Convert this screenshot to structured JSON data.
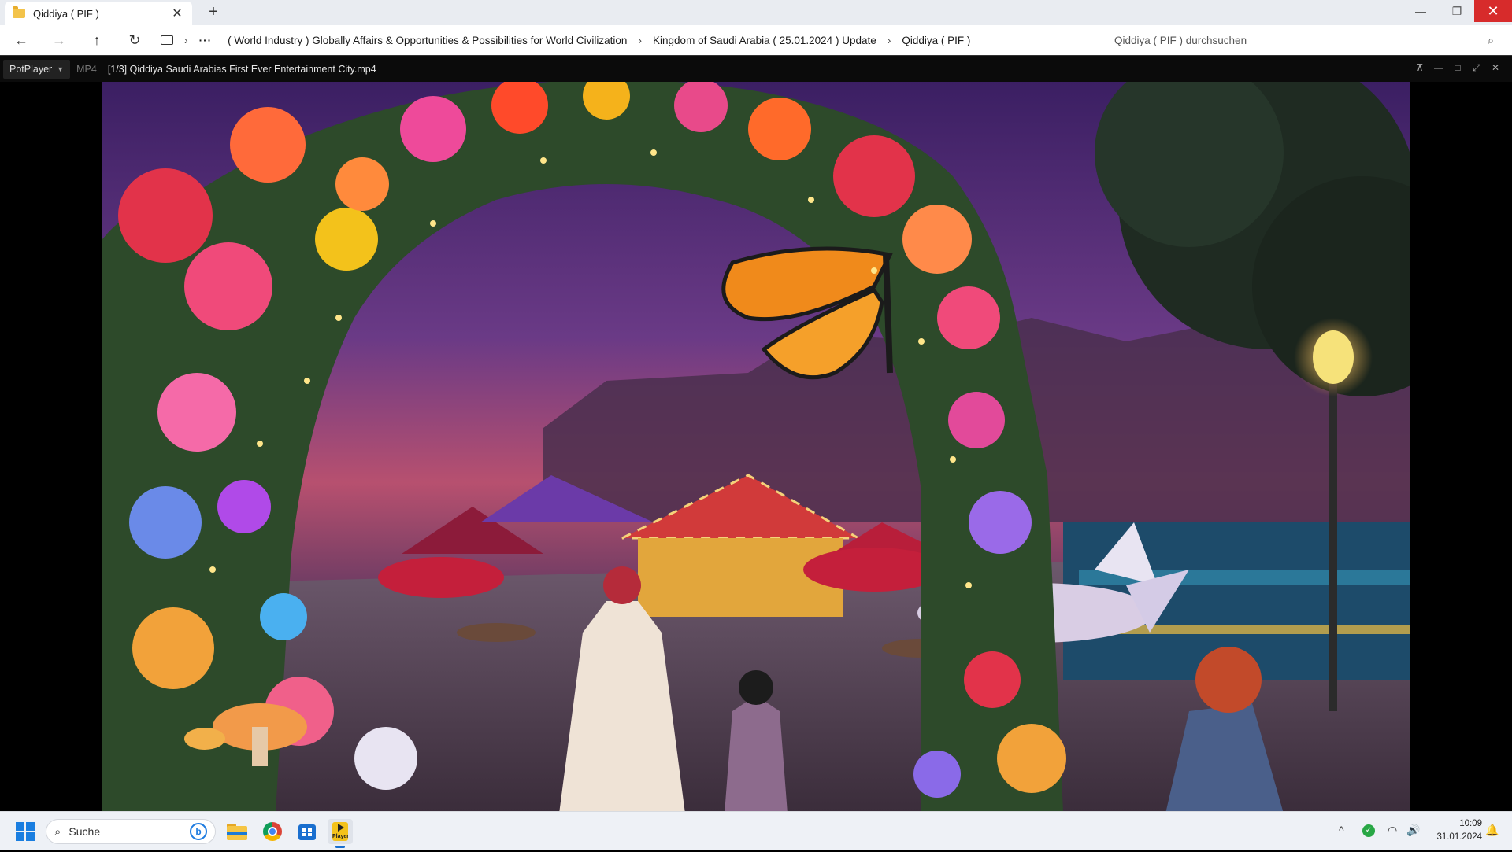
{
  "explorer": {
    "tab_title": "Qiddiya ( PIF )",
    "tab_close": "✕",
    "new_tab": "+",
    "window_controls": {
      "minimize": "—",
      "maximize": "❐",
      "close": "✕"
    },
    "nav": {
      "back": "←",
      "forward": "→",
      "up": "↑",
      "refresh": "↻"
    },
    "breadcrumb": [
      "( World Industry ) Globally Affairs & Opportunities & Possibilities for World Civilization",
      "Kingdom of Saudi Arabia ( 25.01.2024 ) Update",
      "Qiddiya ( PIF )"
    ],
    "breadcrumb_more": "···",
    "breadcrumb_sep": "›",
    "search_placeholder": "Qiddiya ( PIF ) durchsuchen"
  },
  "player": {
    "menu_label": "PotPlayer",
    "format": "MP4",
    "file_title": "[1/3] Qiddiya  Saudi Arabias First Ever Entertainment City.mp4",
    "controls": {
      "pin": "⊼",
      "minimize": "—",
      "maximize": "□",
      "fullscreen": "⤢",
      "close": "✕"
    }
  },
  "taskbar": {
    "search_label": "Suche",
    "bing_label": "b",
    "pot_label": "Player",
    "tray": {
      "chevron": "^",
      "security": "✓",
      "wifi": "◠",
      "volume": "🔊"
    },
    "time": "10:09",
    "date": "31.01.2024"
  },
  "colors": {
    "close_red": "#d72b2b",
    "accent_blue": "#1a7ee0",
    "player_bg": "#0b0b0b"
  }
}
